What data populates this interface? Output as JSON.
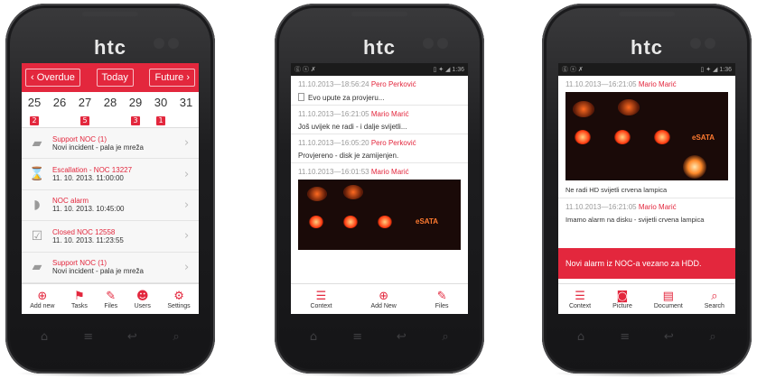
{
  "phones": [
    {
      "brand": "htc"
    },
    {
      "brand": "htc"
    },
    {
      "brand": "htc"
    }
  ],
  "screen1": {
    "nav": {
      "overdue": "‹  Overdue",
      "today": "Today",
      "future": "Future  ›"
    },
    "days": [
      {
        "num": "25",
        "badge": "2"
      },
      {
        "num": "26",
        "badge": ""
      },
      {
        "num": "27",
        "badge": "5"
      },
      {
        "num": "28",
        "badge": ""
      },
      {
        "num": "29",
        "badge": "3"
      },
      {
        "num": "30",
        "badge": "1"
      },
      {
        "num": "31",
        "badge": ""
      }
    ],
    "items": [
      {
        "title": "Support NOC (1)",
        "sub": "Novi incident - pala je mreža",
        "icon": "chat-icon"
      },
      {
        "title": "Escallation - NOC 13227",
        "sub": "11. 10. 2013. 11:00:00",
        "icon": "hourglass-icon"
      },
      {
        "title": "NOC alarm",
        "sub": "11. 10. 2013. 10:45:00",
        "icon": "tag-icon"
      },
      {
        "title": "Closed NOC 12558",
        "sub": "11. 10. 2013. 11:23:55",
        "icon": "checkbox-icon"
      },
      {
        "title": "Support NOC (1)",
        "sub": "Novi incident - pala je mreža",
        "icon": "chat-icon"
      }
    ],
    "toolbar": [
      {
        "label": "Add new",
        "icon": "plus-circle-icon"
      },
      {
        "label": "Tasks",
        "icon": "flag-icon"
      },
      {
        "label": "Files",
        "icon": "paperclip-icon"
      },
      {
        "label": "Users",
        "icon": "users-icon"
      },
      {
        "label": "Settings",
        "icon": "gear-icon"
      }
    ]
  },
  "screen2": {
    "status": {
      "left": "ⓖ ⓢ ✗",
      "right": "▯ ✦ ◢ 1:36"
    },
    "messages": [
      {
        "time": "11.10.2013—18:56:24",
        "who": "Pero Perković",
        "body": "Evo upute za provjeru..."
      },
      {
        "time": "11.10.2013—16:21:05",
        "who": "Mario Marić",
        "body": "Još uvijek ne radi - i dalje svijetli..."
      },
      {
        "time": "11.10.2013—16:05:20",
        "who": "Pero Perković",
        "body": "Provjereno - disk je zamijenjen."
      },
      {
        "time": "11.10.2013—16:01:53",
        "who": "Mario Marić",
        "body": ""
      }
    ],
    "toolbar": [
      {
        "label": "Context",
        "icon": "menu-icon"
      },
      {
        "label": "Add New",
        "icon": "plus-circle-icon"
      },
      {
        "label": "Files",
        "icon": "paperclip-icon"
      }
    ]
  },
  "screen3": {
    "status": {
      "left": "ⓖ ⓢ ✗",
      "right": "▯ ✦ ◢ 1:36"
    },
    "top_msg": {
      "time": "11.10.2013—16:21:05",
      "who": "Mario Marić"
    },
    "caption": "Ne radi HD svijetli crvena lampica",
    "msg2": {
      "time": "11.10.2013—16:21:05",
      "who": "Mario Marić",
      "body": "Imamo alarm na disku - svijetli crvena lampica"
    },
    "banner": "Novi alarm iz NOC-a vezano za HDD.",
    "toolbar": [
      {
        "label": "Context",
        "icon": "menu-icon"
      },
      {
        "label": "Picture",
        "icon": "camera-icon"
      },
      {
        "label": "Document",
        "icon": "document-icon"
      },
      {
        "label": "Search",
        "icon": "search-icon"
      }
    ]
  },
  "hwkeys": [
    "⌂",
    "≡",
    "↩",
    "⌕"
  ],
  "photo_label": "eSATA",
  "accent_color": "#e3273d"
}
